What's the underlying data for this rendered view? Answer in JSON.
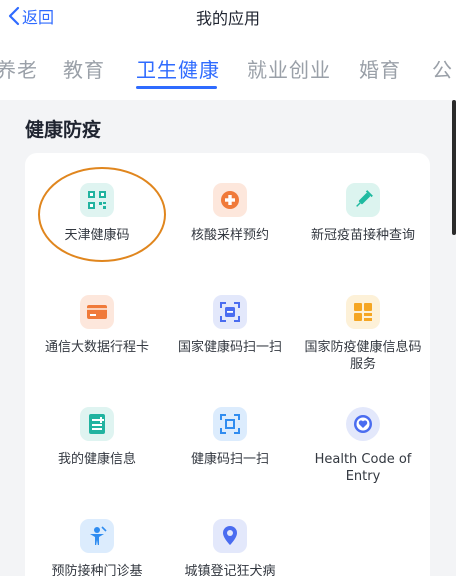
{
  "navbar": {
    "back_label": "返回",
    "title": "我的应用"
  },
  "tabs": [
    {
      "label": "养老",
      "active": false
    },
    {
      "label": "教育",
      "active": false
    },
    {
      "label": "卫生健康",
      "active": true
    },
    {
      "label": "就业创业",
      "active": false
    },
    {
      "label": "婚育",
      "active": false
    },
    {
      "label": "公",
      "active": false
    }
  ],
  "section": {
    "title": "健康防疫",
    "apps": [
      {
        "label": "天津健康码",
        "icon": "qr-code-icon",
        "color": "#21b3a0",
        "highlighted": true
      },
      {
        "label": "核酸采样预约",
        "icon": "medical-cross-icon",
        "color": "#f07a3a"
      },
      {
        "label": "新冠疫苗接种查询",
        "icon": "syringe-icon",
        "color": "#1fbaa0"
      },
      {
        "label": "通信大数据行程卡",
        "icon": "card-icon",
        "color": "#f07a3a"
      },
      {
        "label": "国家健康码扫一扫",
        "icon": "scan-icon",
        "color": "#4a6cf0"
      },
      {
        "label": "国家防疫健康信息码服务",
        "icon": "grid-code-icon",
        "color": "#f5a623"
      },
      {
        "label": "我的健康信息",
        "icon": "health-record-icon",
        "color": "#21b3a0"
      },
      {
        "label": "健康码扫一扫",
        "icon": "scan-frame-icon",
        "color": "#2f8cf0"
      },
      {
        "label": "Health Code of Entry",
        "icon": "heart-badge-icon",
        "color": "#4a6cf0"
      },
      {
        "label": "预防接种门诊基",
        "icon": "vaccination-person-icon",
        "color": "#2f8cf0"
      },
      {
        "label": "城镇登记狂犬病",
        "icon": "location-pin-icon",
        "color": "#4a6cf0"
      }
    ]
  }
}
